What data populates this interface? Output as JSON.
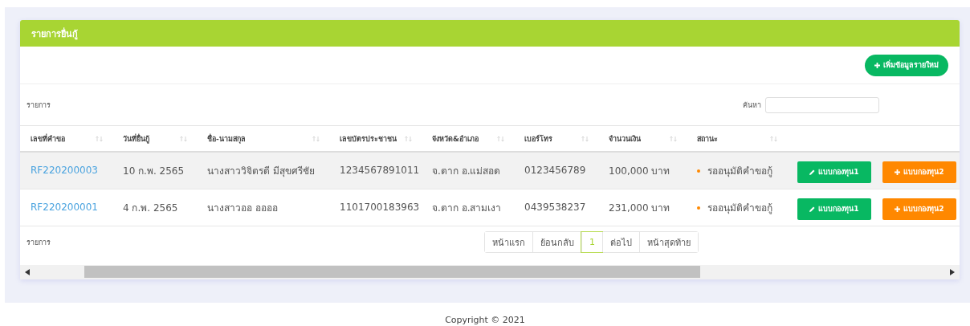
{
  "panel": {
    "title": "รายการยื่นกู้",
    "add_button": "เพิ่มข้อมูลรายใหม่"
  },
  "length_label": "รายการ",
  "search": {
    "label": "ค้นหา"
  },
  "table": {
    "columns": [
      "เลขที่คำขอ",
      "วันที่ยื่นกู้",
      "ชื่อ-นามสกุล",
      "เลขบัตรประชาชน",
      "จังหวัด&อำเภอ",
      "เบอร์โทร",
      "จำนวนเงิน",
      "สถานะ"
    ],
    "rows": [
      {
        "cells": [
          "RF220200003",
          "10 ก.พ. 2565",
          "นางสาววิจิตรดี มีสุขศรีชัย",
          "1234567891011",
          "จ.ตาก อ.แม่สอด",
          "0123456789",
          "100,000 บาท",
          "รออนุมัติคำขอกู้"
        ],
        "color": "#ff8800",
        "actions": [
          {
            "kind": "edit",
            "label": "แบบกองทุน1"
          },
          {
            "kind": "add",
            "label": "แบบกองทุน2"
          }
        ]
      },
      {
        "cells": [
          "RF220200001",
          "4 ก.พ. 2565",
          "นางสาวออ ออออ",
          "1101700183963",
          "จ.ตาก อ.สามเงา",
          "0439538237",
          "231,000 บาท",
          "รออนุมัติคำขอกู้"
        ],
        "color": "#ff8800",
        "actions": [
          {
            "kind": "edit",
            "label": "แบบกองทุน1"
          },
          {
            "kind": "add",
            "label": "แบบกองทุน2"
          }
        ]
      }
    ]
  },
  "info_label": "รายการ",
  "pagination": [
    {
      "label": "หน้าแรก",
      "selected": false
    },
    {
      "label": "ย้อนกลับ",
      "selected": false
    },
    {
      "label": "1",
      "selected": true
    },
    {
      "label": "ต่อไป",
      "selected": false
    },
    {
      "label": "หน้าสุดท้าย",
      "selected": false
    }
  ],
  "footer": "Copyright © 2021"
}
